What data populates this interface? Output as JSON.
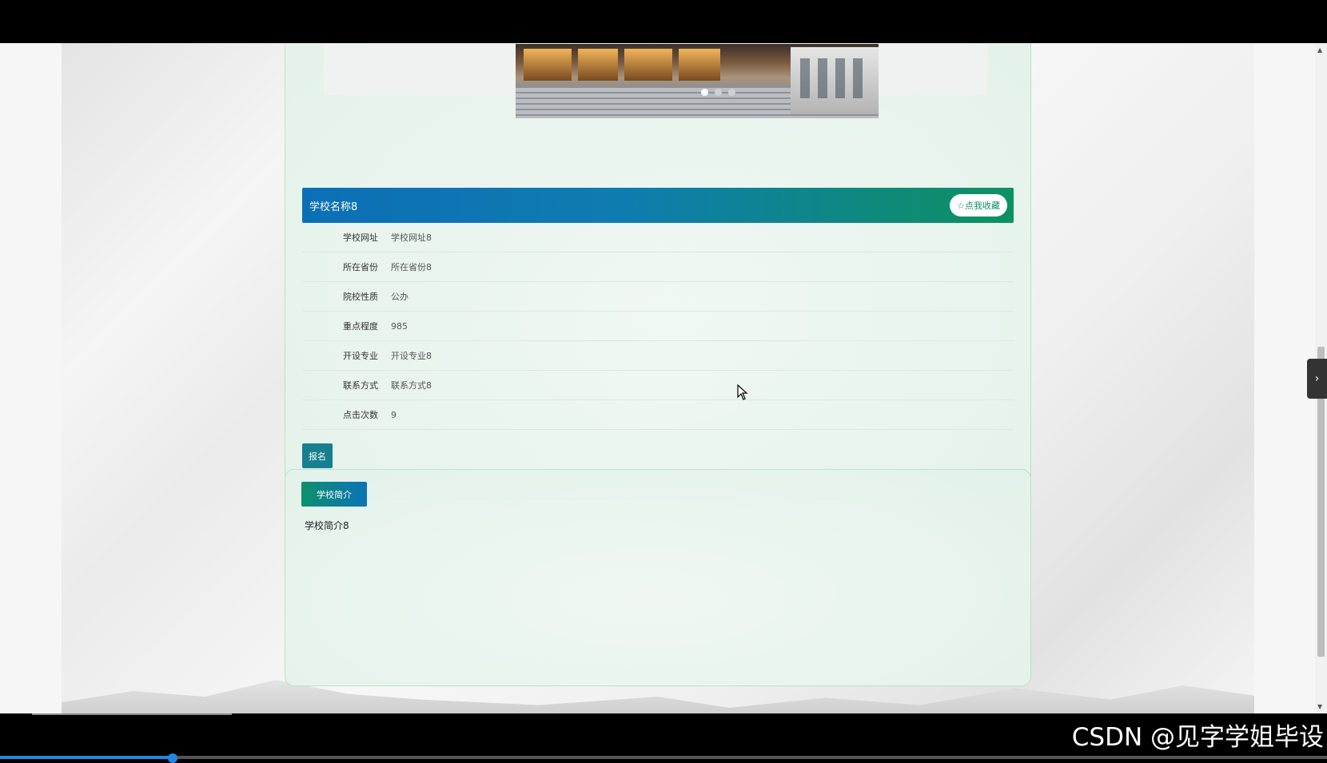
{
  "school": {
    "name": "学校名称8",
    "favorite_label": "☆点我收藏",
    "fields": [
      {
        "label": "学校网址",
        "value": "学校网址8"
      },
      {
        "label": "所在省份",
        "value": "所在省份8"
      },
      {
        "label": "院校性质",
        "value": "公办"
      },
      {
        "label": "重点程度",
        "value": "985"
      },
      {
        "label": "开设专业",
        "value": "开设专业8"
      },
      {
        "label": "联系方式",
        "value": "联系方式8"
      },
      {
        "label": "点击次数",
        "value": "9"
      }
    ],
    "signup_label": "报名"
  },
  "intro": {
    "tab_label": "学校简介",
    "text": "学校简介8"
  },
  "carousel": {
    "slides": 3,
    "active": 1
  },
  "sidebar_toggle": "›",
  "watermark": "CSDN @见字学姐毕设",
  "video_progress_fraction": 0.13
}
